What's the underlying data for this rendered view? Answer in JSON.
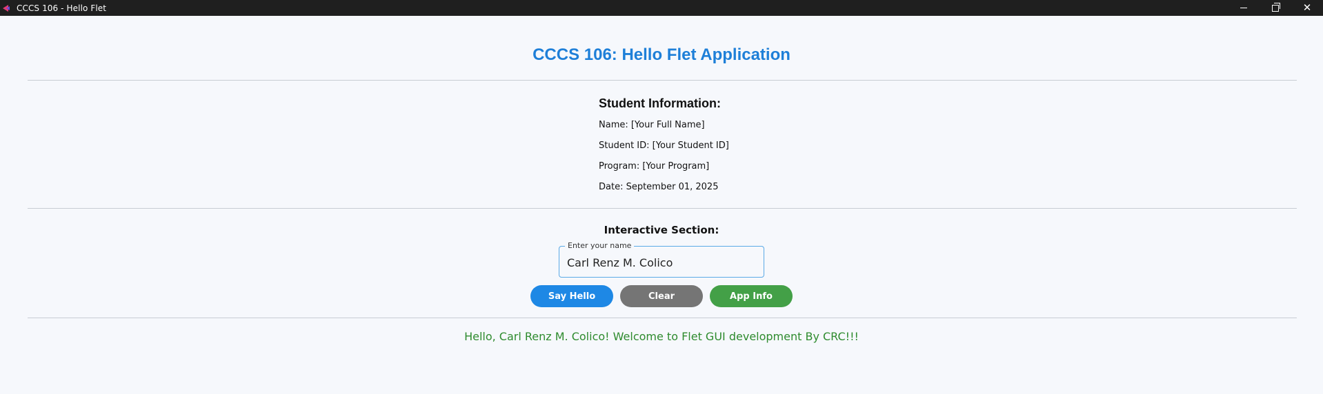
{
  "window": {
    "title": "CCCS 106 - Hello Flet",
    "icon": "flet-app-icon",
    "controls": [
      "minimize-icon",
      "restore-icon",
      "close-icon"
    ]
  },
  "app": {
    "title": "CCCS 106: Hello Flet Application",
    "title_color": "#1e7fd8"
  },
  "student": {
    "heading": "Student Information:",
    "name": "Name: [Your Full Name]",
    "student_id": "Student ID: [Your Student ID]",
    "program": "Program: [Your Program]",
    "date": "Date: September 01, 2025"
  },
  "interactive": {
    "heading": "Interactive Section:",
    "input_label": "Enter your name",
    "input_value": "Carl Renz M. Colico",
    "buttons": {
      "say_hello": "Say Hello",
      "clear": "Clear",
      "app_info": "App Info"
    },
    "button_colors": {
      "say_hello": "#1e88e5",
      "clear": "#757575",
      "app_info": "#43a047"
    }
  },
  "greeting": {
    "text": "Hello, Carl Renz M. Colico! Welcome to Flet GUI development By CRC!!!",
    "color": "#2e8b2e"
  }
}
